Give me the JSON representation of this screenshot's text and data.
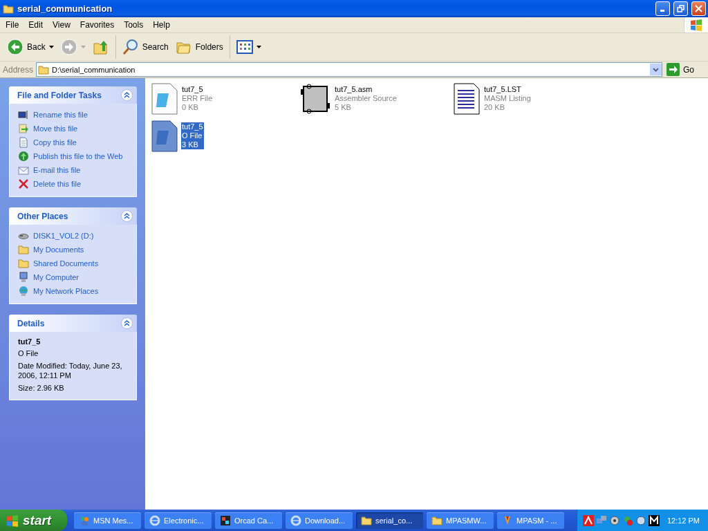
{
  "window": {
    "title": "serial_communication"
  },
  "menu": [
    "File",
    "Edit",
    "View",
    "Favorites",
    "Tools",
    "Help"
  ],
  "toolbar": {
    "back": {
      "label": "Back",
      "disabled": false
    },
    "forward": {
      "disabled": true
    },
    "search": {
      "label": "Search"
    },
    "folders": {
      "label": "Folders"
    }
  },
  "address": {
    "label": "Address",
    "value": "D:\\serial_communication",
    "go": "Go"
  },
  "panels": [
    {
      "title": "File and Folder Tasks",
      "expanded": true,
      "kind": "links",
      "items": [
        "Rename this file",
        "Move this file",
        "Copy this file",
        "Publish this file to the Web",
        "E-mail this file",
        "Delete this file"
      ]
    },
    {
      "title": "Other Places",
      "expanded": true,
      "kind": "places",
      "items": [
        "DISK1_VOL2 (D:)",
        "My Documents",
        "Shared Documents",
        "My Computer",
        "My Network Places"
      ]
    },
    {
      "title": "Details",
      "expanded": true,
      "kind": "details",
      "name": "tut7_5",
      "type": "O File",
      "lines": [
        "Date Modified: Today, June 23, 2006, 12:11 PM",
        "Size: 2.96 KB"
      ]
    }
  ],
  "files": [
    {
      "name": "tut7_5",
      "type": "ERR File",
      "size": "0 KB",
      "kind": "err",
      "selected": false
    },
    {
      "name": "tut7_5.asm",
      "type": "Assembler Source",
      "size": "5 KB",
      "kind": "asm",
      "selected": false
    },
    {
      "name": "tut7_5.LST",
      "type": "MASM Listing",
      "size": "20 KB",
      "kind": "lst",
      "selected": false
    },
    {
      "name": "tut7_5",
      "type": "O File",
      "size": "3 KB",
      "kind": "obj",
      "selected": true
    }
  ],
  "taskbar": {
    "start": "start",
    "buttons": [
      {
        "label": "MSN Mes...",
        "selected": false
      },
      {
        "label": "Electronic...",
        "selected": false
      },
      {
        "label": "Orcad Ca...",
        "selected": false
      },
      {
        "label": "Download...",
        "selected": false
      },
      {
        "label": "serial_co...",
        "selected": true
      },
      {
        "label": "MPASMW...",
        "selected": false
      },
      {
        "label": "MPASM - ...",
        "selected": false
      }
    ],
    "clock": "12:12 PM"
  }
}
